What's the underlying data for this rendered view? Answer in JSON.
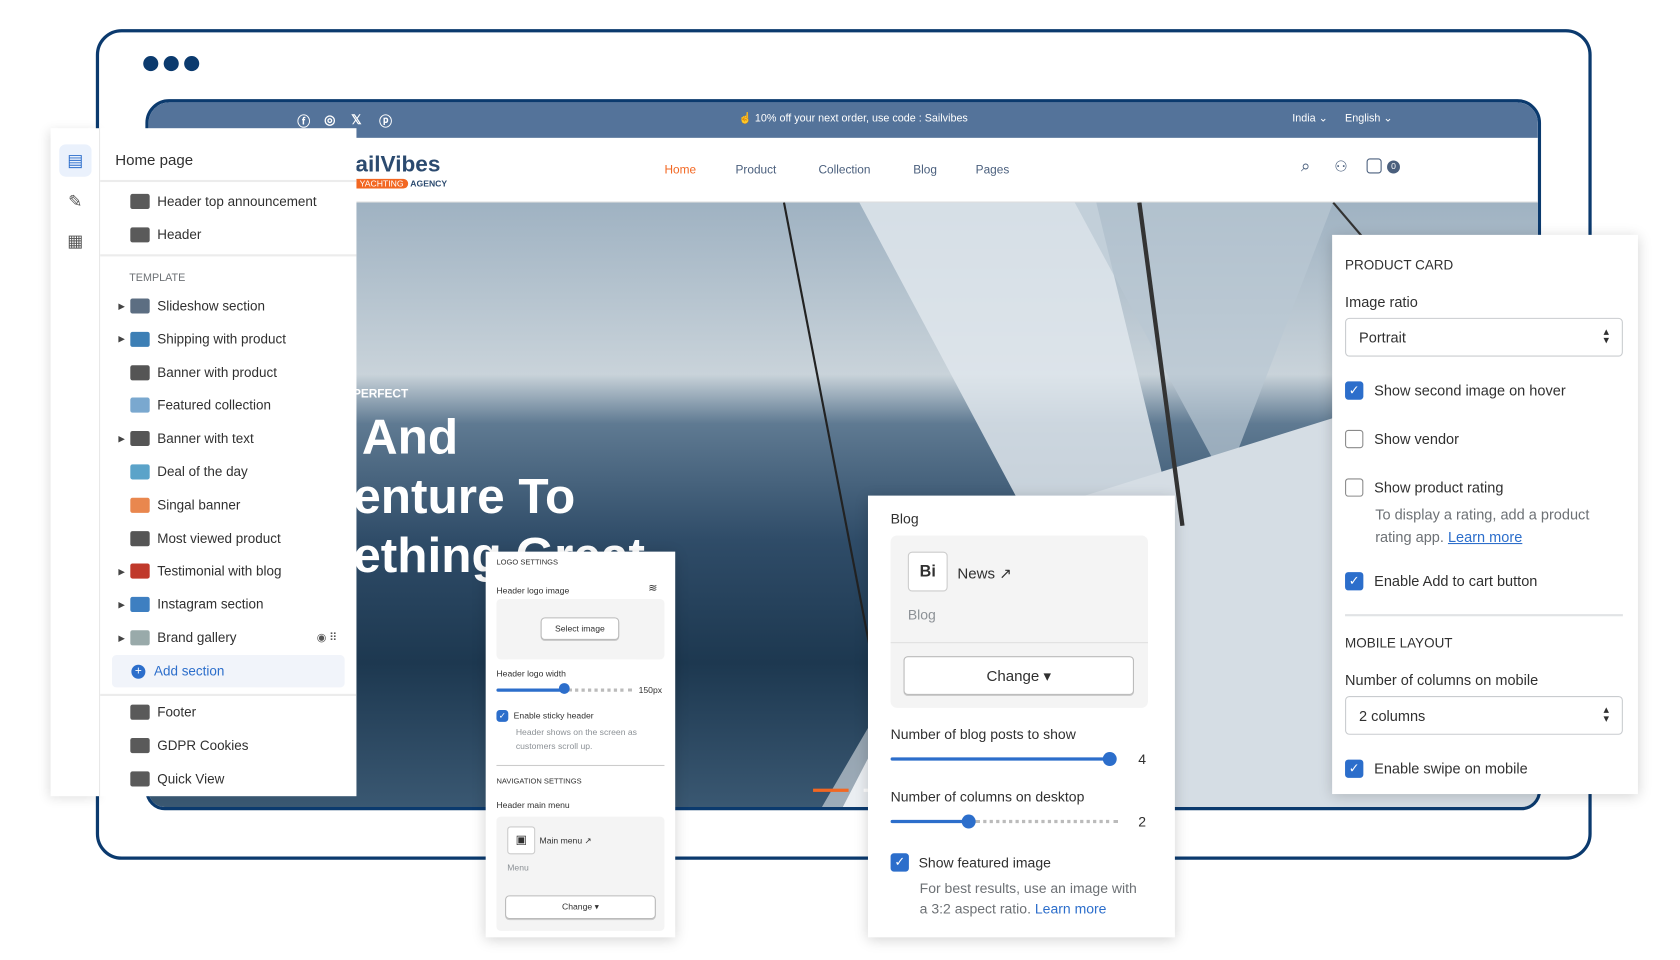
{
  "window": {
    "dots": 3,
    "frame_color": "#0b3a6e"
  },
  "store": {
    "announcement": "10% off your next order, use code : Sailvibes",
    "social_icons": [
      "facebook-icon",
      "instagram-icon",
      "x-icon",
      "pinterest-icon"
    ],
    "country": "India",
    "language": "English",
    "logo": {
      "name": "SailVibes",
      "visible": "ailVibes",
      "tag1": "YACHTING",
      "tag2": "AGENCY"
    },
    "nav": [
      "Home",
      "Product",
      "Collection",
      "Blog",
      "Pages"
    ],
    "active_nav": "Home",
    "cart_count": "0",
    "accent": "#f26722",
    "topbar_color": "#54739a",
    "hero": {
      "kicker": "OR A PERFECT",
      "line1": "And",
      "line2": "enture To",
      "line3": "ething Great"
    }
  },
  "sidebar": {
    "title": "Home page",
    "header_items": [
      "Header top announcement",
      "Header"
    ],
    "template_label": "TEMPLATE",
    "template_items": [
      {
        "label": "Slideshow section",
        "expandable": true
      },
      {
        "label": "Shipping with product",
        "expandable": true
      },
      {
        "label": "Banner with product",
        "expandable": false
      },
      {
        "label": "Featured collection",
        "expandable": false
      },
      {
        "label": "Banner with text",
        "expandable": true
      },
      {
        "label": "Deal of the day",
        "expandable": false
      },
      {
        "label": "Singal banner",
        "expandable": false
      },
      {
        "label": "Most viewed product",
        "expandable": false
      },
      {
        "label": "Testimonial with blog",
        "expandable": true
      },
      {
        "label": "Instagram section",
        "expandable": true
      },
      {
        "label": "Brand gallery",
        "expandable": true
      }
    ],
    "add_section": "Add section",
    "footer_items": [
      "Footer",
      "GDPR Cookies",
      "Quick View"
    ]
  },
  "logo_settings": {
    "heading": "LOGO SETTINGS",
    "logo_image_label": "Header logo image",
    "select_image": "Select image",
    "logo_width_label": "Header logo width",
    "logo_width_value": "150px",
    "logo_width_fraction": 0.35,
    "sticky_label": "Enable sticky header",
    "sticky_checked": true,
    "sticky_help1": "Header shows on the screen as",
    "sticky_help2": "customers scroll up.",
    "nav_heading": "NAVIGATION SETTINGS",
    "menu_label": "Header main menu",
    "menu_name": "Main menu",
    "menu_type": "Menu",
    "change": "Change"
  },
  "blog_panel": {
    "title": "Blog",
    "blog_name": "News",
    "blog_type": "Blog",
    "change": "Change",
    "posts_label": "Number of blog posts to show",
    "posts_value": "4",
    "posts_fraction": 1.0,
    "columns_label": "Number of columns on desktop",
    "columns_value": "2",
    "columns_fraction": 0.35,
    "featured_label": "Show featured image",
    "featured_checked": true,
    "featured_help1": "For best results, use an image with",
    "featured_help2": "a 3:2 aspect ratio.",
    "learn_more": "Learn more"
  },
  "product_card": {
    "heading": "PRODUCT CARD",
    "image_ratio_label": "Image ratio",
    "image_ratio_value": "Portrait",
    "second_image": "Show second image on hover",
    "vendor": "Show vendor",
    "rating": "Show product rating",
    "rating_help1": "To display a rating, add a product",
    "rating_help2": "rating app.",
    "learn_more": "Learn more",
    "add_to_cart": "Enable Add to cart button",
    "mobile_heading": "MOBILE LAYOUT",
    "columns_label": "Number of columns on mobile",
    "columns_value": "2 columns",
    "swipe": "Enable swipe on mobile",
    "checked": {
      "second_image": true,
      "vendor": false,
      "rating": false,
      "add_to_cart": true,
      "swipe": true
    }
  }
}
